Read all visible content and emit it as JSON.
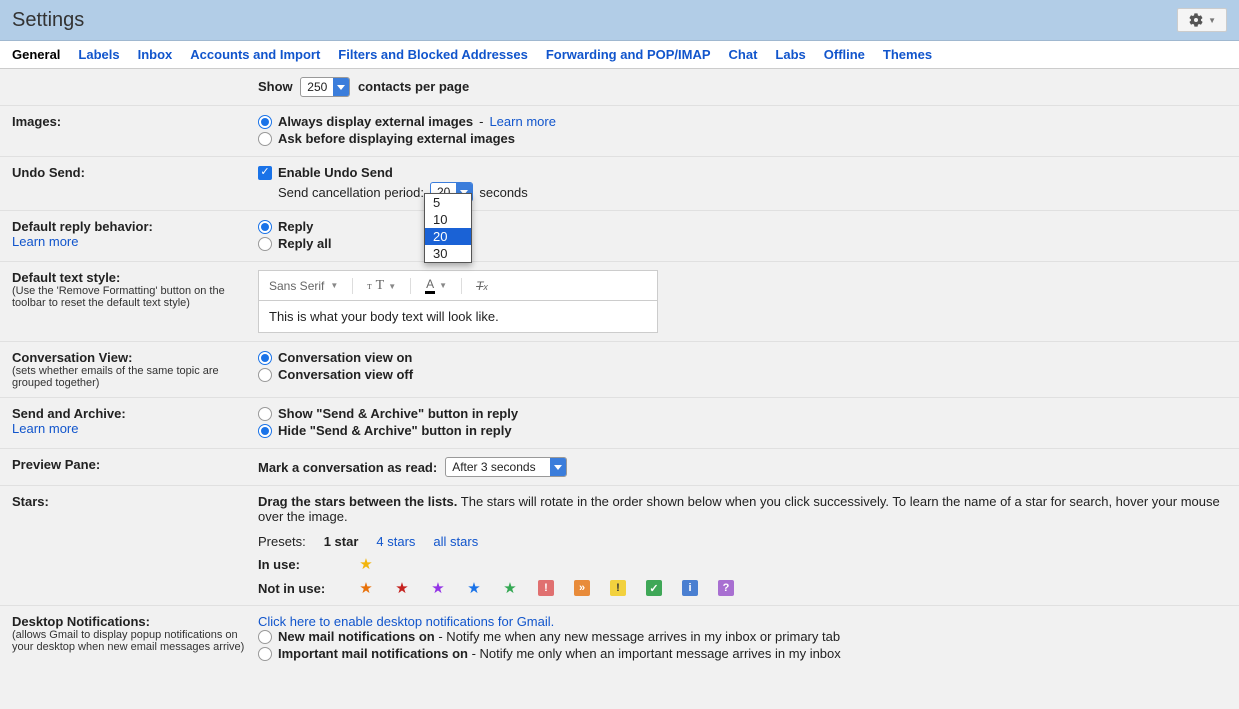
{
  "header": {
    "title": "Settings"
  },
  "tabs": [
    "General",
    "Labels",
    "Inbox",
    "Accounts and Import",
    "Filters and Blocked Addresses",
    "Forwarding and POP/IMAP",
    "Chat",
    "Labs",
    "Offline",
    "Themes"
  ],
  "contacts": {
    "show": "Show",
    "value": "250",
    "per_page": "contacts per page"
  },
  "images": {
    "label": "Images:",
    "opt1": "Always display external images",
    "opt2": "Ask before displaying external images",
    "learn": "Learn more"
  },
  "undo": {
    "label": "Undo Send:",
    "enable": "Enable Undo Send",
    "period": "Send cancellation period:",
    "value": "20",
    "seconds": "seconds",
    "options": [
      "5",
      "10",
      "20",
      "30"
    ]
  },
  "reply": {
    "label": "Default reply behavior:",
    "learn": "Learn more",
    "opt1": "Reply",
    "opt2": "Reply all"
  },
  "textstyle": {
    "label": "Default text style:",
    "sub": "(Use the 'Remove Formatting' button on the toolbar to reset the default text style)",
    "font": "Sans Serif",
    "sample": "This is what your body text will look like."
  },
  "conv": {
    "label": "Conversation View:",
    "sub": "(sets whether emails of the same topic are grouped together)",
    "opt1": "Conversation view on",
    "opt2": "Conversation view off"
  },
  "sendarchive": {
    "label": "Send and Archive:",
    "learn": "Learn more",
    "opt1": "Show \"Send & Archive\" button in reply",
    "opt2": "Hide \"Send & Archive\" button in reply"
  },
  "preview": {
    "label": "Preview Pane:",
    "mark": "Mark a conversation as read:",
    "value": "After 3 seconds"
  },
  "stars": {
    "label": "Stars:",
    "drag": "Drag the stars between the lists.",
    "desc": "The stars will rotate in the order shown below when you click successively. To learn the name of a star for search, hover your mouse over the image.",
    "presets": "Presets:",
    "p1": "1 star",
    "p4": "4 stars",
    "pall": "all stars",
    "inuse": "In use:",
    "notinuse": "Not in use:"
  },
  "desktop": {
    "label": "Desktop Notifications:",
    "sub": "(allows Gmail to display popup notifications on your desktop when new email messages arrive)",
    "enable": "Click here to enable desktop notifications for Gmail.",
    "opt1": "New mail notifications on",
    "opt1d": " - Notify me when any new message arrives in my inbox or primary tab",
    "opt2": "Important mail notifications on",
    "opt2d": " - Notify me only when an important message arrives in my inbox"
  }
}
